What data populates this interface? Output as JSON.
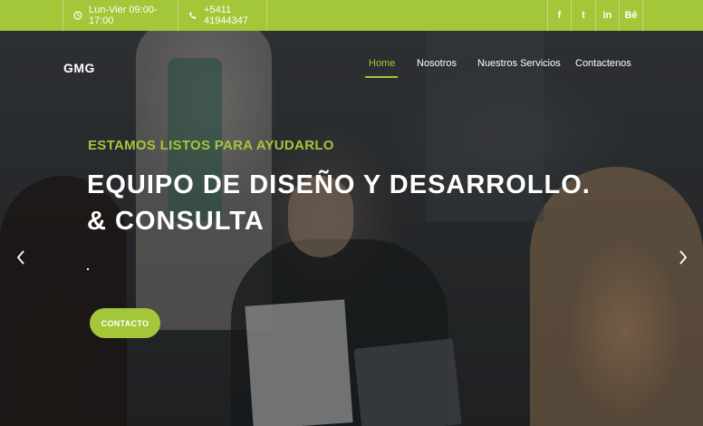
{
  "topbar": {
    "hours": "Lun-Vier 09:00-17:00",
    "phone": "+5411 41944347",
    "social": {
      "facebook": "f",
      "twitter": "t",
      "linkedin": "in",
      "behance": "Bē"
    },
    "icons": {
      "hours": "clock-icon",
      "phone": "phone-icon"
    }
  },
  "header": {
    "logo": "GMG",
    "nav": [
      "Home",
      "Nosotros",
      "Nuestros Servicios",
      "Contactenos"
    ],
    "active_nav": "Home"
  },
  "hero": {
    "subtitle": "ESTAMOS LISTOS PARA AYUDARLO",
    "headline_line1": "EQUIPO DE DISEÑO Y DESARROLLO.",
    "headline_line2": "& CONSULTA",
    "cta_label": "CONTACTO",
    "prev_icon": "chevron-left-icon",
    "next_icon": "chevron-right-icon"
  },
  "colors": {
    "accent": "#a4c639",
    "text": "#ffffff"
  }
}
